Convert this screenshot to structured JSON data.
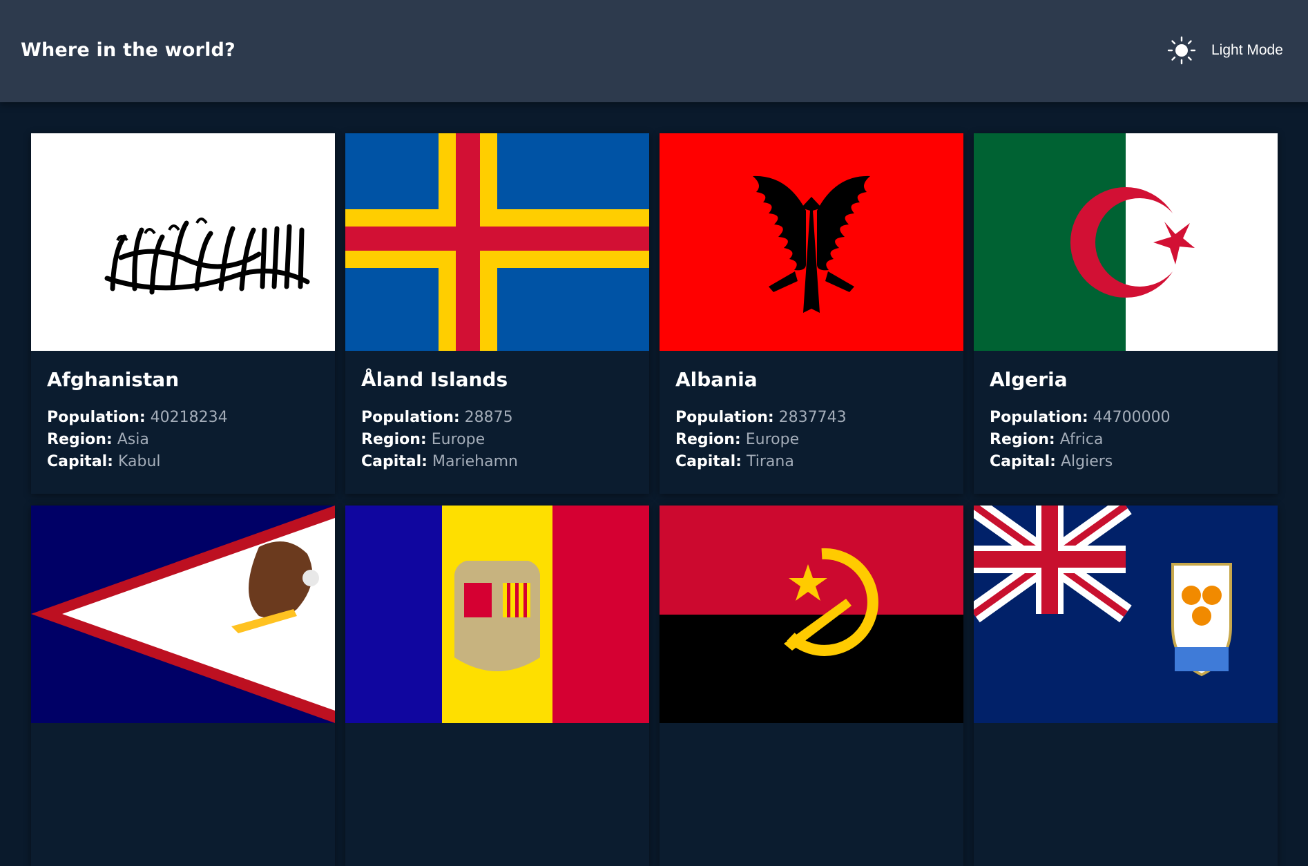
{
  "header": {
    "title": "Where in the world?",
    "theme_toggle": {
      "label": "Light Mode",
      "icon": "sun-icon"
    }
  },
  "labels": {
    "population": "Population:",
    "region": "Region:",
    "capital": "Capital:"
  },
  "countries": [
    {
      "name": "Afghanistan",
      "population": "40218234",
      "region": "Asia",
      "capital": "Kabul",
      "flag_icon": "afghanistan-flag"
    },
    {
      "name": "Åland Islands",
      "population": "28875",
      "region": "Europe",
      "capital": "Mariehamn",
      "flag_icon": "aland-islands-flag"
    },
    {
      "name": "Albania",
      "population": "2837743",
      "region": "Europe",
      "capital": "Tirana",
      "flag_icon": "albania-flag"
    },
    {
      "name": "Algeria",
      "population": "44700000",
      "region": "Africa",
      "capital": "Algiers",
      "flag_icon": "algeria-flag"
    },
    {
      "flag_icon": "american-samoa-flag"
    },
    {
      "flag_icon": "andorra-flag"
    },
    {
      "flag_icon": "angola-flag"
    },
    {
      "flag_icon": "anguilla-flag"
    }
  ],
  "colors": {
    "background": "#0a1a2c",
    "header": "#2d3a4d",
    "card": "#0b1c2f",
    "value_text": "#a4adb9"
  }
}
